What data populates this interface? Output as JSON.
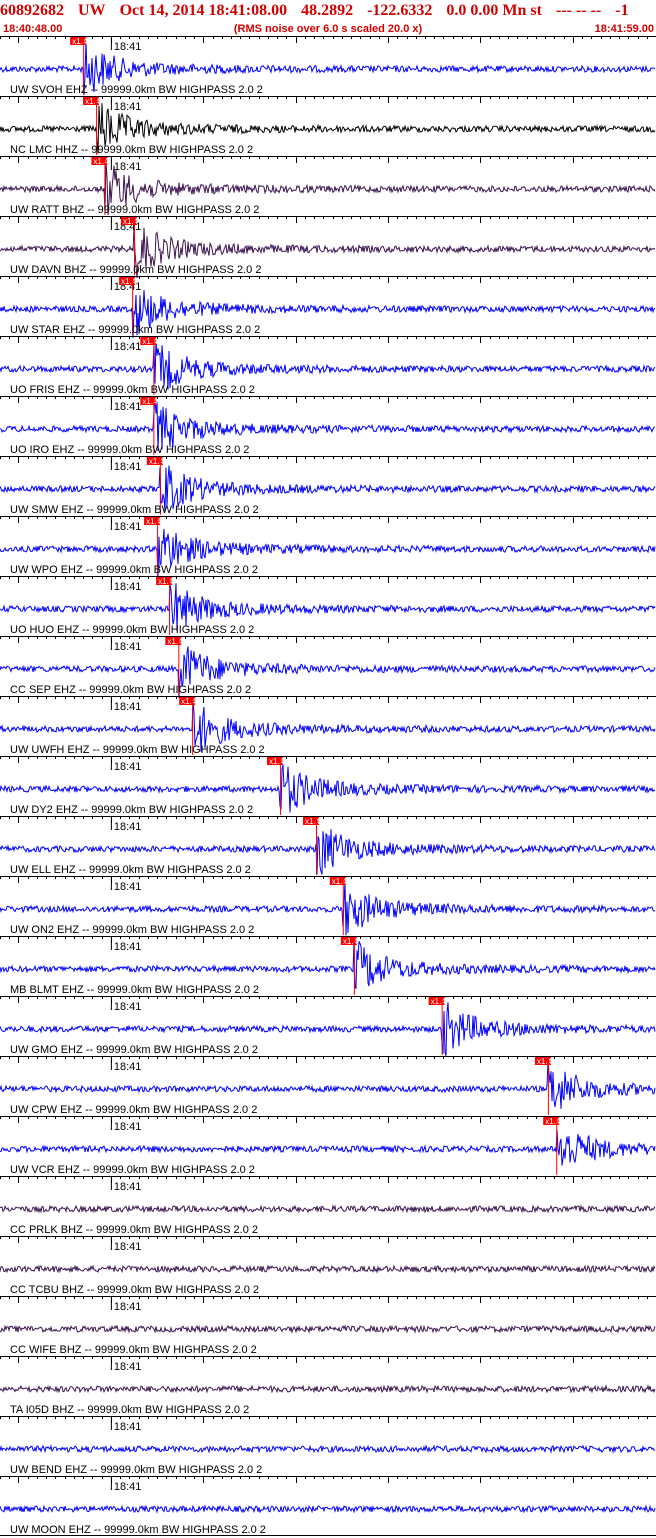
{
  "header": {
    "event_id": "60892682",
    "network": "UW",
    "datetime": "Oct 14, 2014 18:41:08.00",
    "latitude": "48.2892",
    "longitude": "-122.6332",
    "depth_mag": "0.0 0.00 Mn st",
    "trailer": "--- -- --",
    "count": "-1",
    "start_time": "18:40:48.00",
    "end_time": "18:41:59.00",
    "note": "(RMS noise over 6.0 s scaled 20.0 x)"
  },
  "chart_data": {
    "type": "line",
    "title": "60892682 UW Oct 14, 2014 18:41:08.00 48.2892 -122.6332 0.0 0.00 Mn st --- -- -- -1",
    "x_axis": {
      "start": "18:40:48.00",
      "end": "18:41:59.00",
      "minute_label": "18:41",
      "minute_offset_s": 12
    },
    "pick_label": "x1.4",
    "colors": {
      "blue": "#0000ff",
      "black": "#000000",
      "purple": "#3c1450",
      "pick": "#ff0000",
      "text": "#d40000"
    },
    "series": [
      {
        "name": "UW SVOH EHZ -- 99999.0km BW  HIGHPASS  2.0  2",
        "pick_s": 9.0,
        "color": "blue"
      },
      {
        "name": "NC LMC HHZ -- 99999.0km BW  HIGHPASS  2.0  2",
        "pick_s": 10.4,
        "color": "black"
      },
      {
        "name": "UW RATT BHZ -- 99999.0km BW  HIGHPASS  2.0  2",
        "pick_s": 11.3,
        "color": "purple"
      },
      {
        "name": "UW DAVN BHZ -- 99999.0km BW  HIGHPASS  2.0  2",
        "pick_s": 14.5,
        "color": "purple"
      },
      {
        "name": "UW STAR EHZ -- 99999.0km BW  HIGHPASS  2.0  2",
        "pick_s": 14.3,
        "color": "blue"
      },
      {
        "name": "UO FRIS EHZ -- 99999.0km BW  HIGHPASS  2.0  2",
        "pick_s": 16.6,
        "color": "blue"
      },
      {
        "name": "UO IRO EHZ -- 99999.0km BW  HIGHPASS  2.0  2",
        "pick_s": 16.6,
        "color": "blue"
      },
      {
        "name": "UW SMW EHZ -- 99999.0km BW  HIGHPASS  2.0  2",
        "pick_s": 17.3,
        "color": "blue"
      },
      {
        "name": "UW WPO EHZ -- 99999.0km BW  HIGHPASS  2.0  2",
        "pick_s": 17.0,
        "color": "blue"
      },
      {
        "name": "UO HUO EHZ -- 99999.0km BW  HIGHPASS  2.0  2",
        "pick_s": 18.3,
        "color": "blue"
      },
      {
        "name": "CC SEP EHZ -- 99999.0km BW  HIGHPASS  2.0  2",
        "pick_s": 19.3,
        "color": "blue"
      },
      {
        "name": "UW UWFH EHZ -- 99999.0km BW  HIGHPASS  2.0  2",
        "pick_s": 20.8,
        "color": "blue"
      },
      {
        "name": "UW DY2 EHZ -- 99999.0km BW  HIGHPASS  2.0  2",
        "pick_s": 30.3,
        "color": "blue"
      },
      {
        "name": "UW ELL EHZ -- 99999.0km BW  HIGHPASS  2.0  2",
        "pick_s": 34.2,
        "color": "blue"
      },
      {
        "name": "UW ON2 EHZ -- 99999.0km BW  HIGHPASS  2.0  2",
        "pick_s": 37.1,
        "color": "blue"
      },
      {
        "name": "MB BLMT EHZ -- 99999.0km BW  HIGHPASS  2.0  2",
        "pick_s": 38.3,
        "color": "blue"
      },
      {
        "name": "UW GMO EHZ -- 99999.0km BW  HIGHPASS  2.0  2",
        "pick_s": 47.8,
        "color": "blue"
      },
      {
        "name": "UW CPW EHZ -- 99999.0km BW  HIGHPASS  2.0  2",
        "pick_s": 59.3,
        "color": "blue"
      },
      {
        "name": "UW VCR EHZ -- 99999.0km BW  HIGHPASS  2.0  2",
        "pick_s": 60.2,
        "color": "blue"
      },
      {
        "name": "CC PRLK BHZ -- 99999.0km BW  HIGHPASS  2.0  2",
        "pick_s": null,
        "color": "purple"
      },
      {
        "name": "CC TCBU BHZ -- 99999.0km BW  HIGHPASS  2.0  2",
        "pick_s": null,
        "color": "purple"
      },
      {
        "name": "CC WIFE BHZ -- 99999.0km BW  HIGHPASS  2.0  2",
        "pick_s": null,
        "color": "purple"
      },
      {
        "name": "TA I05D BHZ -- 99999.0km BW  HIGHPASS  2.0  2",
        "pick_s": null,
        "color": "purple"
      },
      {
        "name": "UW BEND EHZ -- 99999.0km BW  HIGHPASS  2.0  2",
        "pick_s": null,
        "color": "blue"
      },
      {
        "name": "UW MOON EHZ -- 99999.0km BW  HIGHPASS  2.0  2",
        "pick_s": null,
        "color": "blue"
      }
    ]
  }
}
